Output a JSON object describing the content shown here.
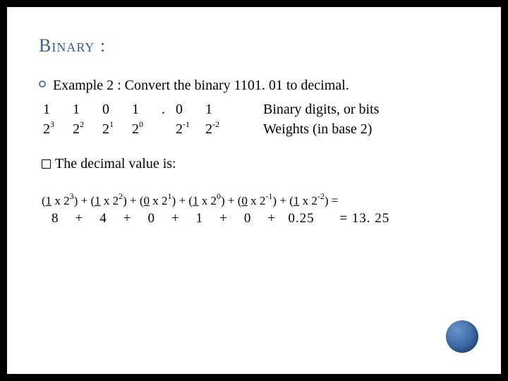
{
  "title": "Binary :",
  "example": {
    "prefix": "Example 2 : Convert the binary ",
    "number": "1101. 01",
    "suffix": " to decimal."
  },
  "digits": {
    "row": [
      "1",
      "1",
      "0",
      "1",
      ".",
      "0",
      "1"
    ],
    "label": "Binary digits, or bits"
  },
  "weights": {
    "bases": [
      "2",
      "2",
      "2",
      "2",
      "2",
      "2"
    ],
    "exps": [
      "3",
      "2",
      "1",
      "0",
      "-1",
      "-2"
    ],
    "label": "Weights (in base 2)"
  },
  "decimal_line": "The decimal value is:",
  "expansion": {
    "terms": [
      {
        "d": "1",
        "b": "2",
        "e": "3"
      },
      {
        "d": "1",
        "b": "2",
        "e": "2"
      },
      {
        "d": "0",
        "b": "2",
        "e": "1"
      },
      {
        "d": "1",
        "b": "2",
        "e": "0"
      },
      {
        "d": "0",
        "b": "2",
        "e": "-1"
      },
      {
        "d": "1",
        "b": "2",
        "e": "-2"
      }
    ],
    "eq": "="
  },
  "sum": {
    "values": [
      "8",
      "4",
      "0",
      "1",
      "0",
      "0.25"
    ],
    "plus": "+",
    "eq": "= 13. 25"
  }
}
